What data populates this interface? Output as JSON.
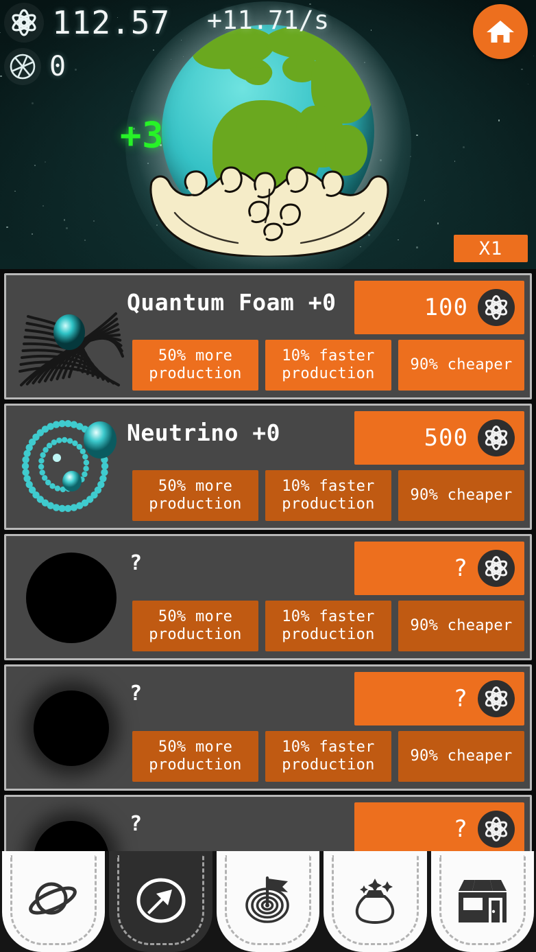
{
  "header": {
    "atoms_icon": "atom-icon",
    "atoms_value": "112.57",
    "aperture_icon": "aperture-icon",
    "aperture_value": "0",
    "rate": "+11.71/s",
    "home_icon": "home-icon"
  },
  "stage": {
    "floating_gain": "+3",
    "earth_icon": "earth-in-hands-illustration",
    "multiplier_label": "X1"
  },
  "colors": {
    "accent_orange": "#ED6F1E",
    "accent_orange_dim": "#C05A12",
    "card_body": "#474747",
    "card_border": "#B9B9B9",
    "background_teal": "#0F2E2E",
    "gain_green": "#27F327",
    "cyan": "#36C2C6"
  },
  "upgrade_labels": {
    "more_production": "50% more production",
    "faster_production": "10% faster production",
    "cheaper": "90% cheaper"
  },
  "cards": [
    {
      "name": "Quantum Foam +0",
      "price": "100",
      "icon": "quantum-foam-grid-icon",
      "affordable": true,
      "locked": false,
      "upgrades": [
        {
          "l1": "50% more",
          "l2": "production"
        },
        {
          "l1": "10% faster",
          "l2": "production"
        },
        {
          "l1": "90% cheaper",
          "l2": ""
        }
      ]
    },
    {
      "name": "Neutrino +0",
      "price": "500",
      "icon": "neutrino-orbit-icon",
      "affordable": false,
      "locked": false,
      "upgrades": [
        {
          "l1": "50% more",
          "l2": "production"
        },
        {
          "l1": "10% faster",
          "l2": "production"
        },
        {
          "l1": "90% cheaper",
          "l2": ""
        }
      ]
    },
    {
      "name": "?",
      "price": "?",
      "icon": "locked-black-circle-icon",
      "affordable": false,
      "locked": true,
      "upgrades": [
        {
          "l1": "50% more",
          "l2": "production"
        },
        {
          "l1": "10% faster",
          "l2": "production"
        },
        {
          "l1": "90% cheaper",
          "l2": ""
        }
      ]
    },
    {
      "name": "?",
      "price": "?",
      "icon": "locked-black-circle-icon",
      "affordable": false,
      "locked": true,
      "upgrades": [
        {
          "l1": "50% more",
          "l2": "production"
        },
        {
          "l1": "10% faster",
          "l2": "production"
        },
        {
          "l1": "90% cheaper",
          "l2": ""
        }
      ]
    },
    {
      "name": "?",
      "price": "?",
      "icon": "locked-black-circle-icon",
      "affordable": false,
      "locked": true,
      "upgrades": []
    }
  ],
  "nav": {
    "tabs": [
      {
        "id": "planet",
        "icon": "planet-icon",
        "active": false
      },
      {
        "id": "energy",
        "icon": "lightning-circle-icon",
        "active": true
      },
      {
        "id": "achievements",
        "icon": "target-flag-icon",
        "active": false
      },
      {
        "id": "rewards",
        "icon": "money-bag-icon",
        "active": false
      },
      {
        "id": "shop",
        "icon": "shop-icon",
        "active": false
      }
    ]
  }
}
